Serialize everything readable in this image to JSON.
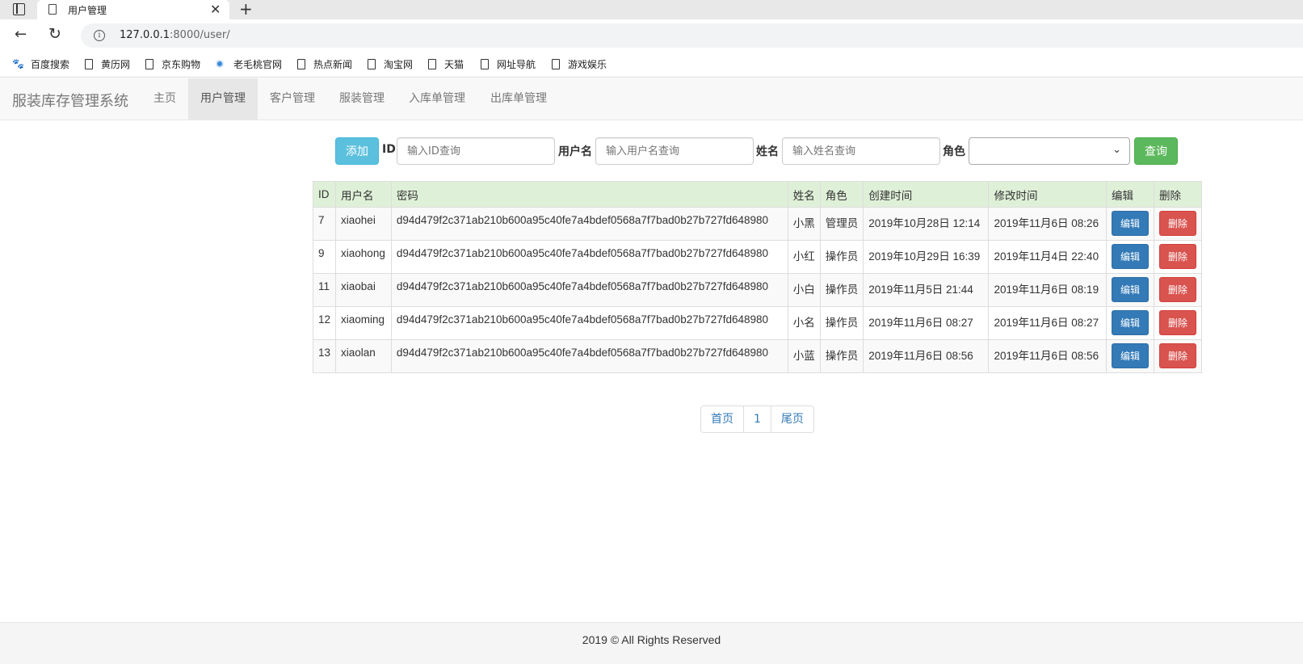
{
  "browser": {
    "tab_title": "用户管理",
    "url_host": "127.0.0.1",
    "url_rest": ":8000/user/",
    "bookmarks": [
      "百度搜索",
      "黄历网",
      "京东购物",
      "老毛桃官网",
      "热点新闻",
      "淘宝网",
      "天猫",
      "网址导航",
      "游戏娱乐"
    ]
  },
  "navbar": {
    "brand": "服装库存管理系统",
    "items": [
      "主页",
      "用户管理",
      "客户管理",
      "服装管理",
      "入库单管理",
      "出库单管理"
    ],
    "active_index": 1
  },
  "search": {
    "add_label": "添加",
    "id_label": "ID",
    "id_placeholder": "输入ID查询",
    "username_label": "用户名",
    "username_placeholder": "输入用户名查询",
    "name_label": "姓名",
    "name_placeholder": "输入姓名查询",
    "role_label": "角色",
    "role_value": "",
    "query_label": "查询"
  },
  "table": {
    "headers": [
      "ID",
      "用户名",
      "密码",
      "姓名",
      "角色",
      "创建时间",
      "修改时间",
      "编辑",
      "删除"
    ],
    "edit_label": "编辑",
    "delete_label": "删除",
    "rows": [
      [
        "7",
        "xiaohei",
        "d94d479f2c371ab210b600a95c40fe7a4bdef0568a7f7bad0b27b727fd648980",
        "小黑",
        "管理员",
        "2019年10月28日 12:14",
        "2019年11月6日 08:26"
      ],
      [
        "9",
        "xiaohong",
        "d94d479f2c371ab210b600a95c40fe7a4bdef0568a7f7bad0b27b727fd648980",
        "小红",
        "操作员",
        "2019年10月29日 16:39",
        "2019年11月4日 22:40"
      ],
      [
        "11",
        "xiaobai",
        "d94d479f2c371ab210b600a95c40fe7a4bdef0568a7f7bad0b27b727fd648980",
        "小白",
        "操作员",
        "2019年11月5日 21:44",
        "2019年11月6日 08:19"
      ],
      [
        "12",
        "xiaoming",
        "d94d479f2c371ab210b600a95c40fe7a4bdef0568a7f7bad0b27b727fd648980",
        "小名",
        "操作员",
        "2019年11月6日 08:27",
        "2019年11月6日 08:27"
      ],
      [
        "13",
        "xiaolan",
        "d94d479f2c371ab210b600a95c40fe7a4bdef0568a7f7bad0b27b727fd648980",
        "小蓝",
        "操作员",
        "2019年11月6日 08:56",
        "2019年11月6日 08:56"
      ]
    ]
  },
  "pagination": {
    "first": "首页",
    "current": "1",
    "last": "尾页"
  },
  "footer": {
    "text": "2019 © All Rights Reserved"
  }
}
